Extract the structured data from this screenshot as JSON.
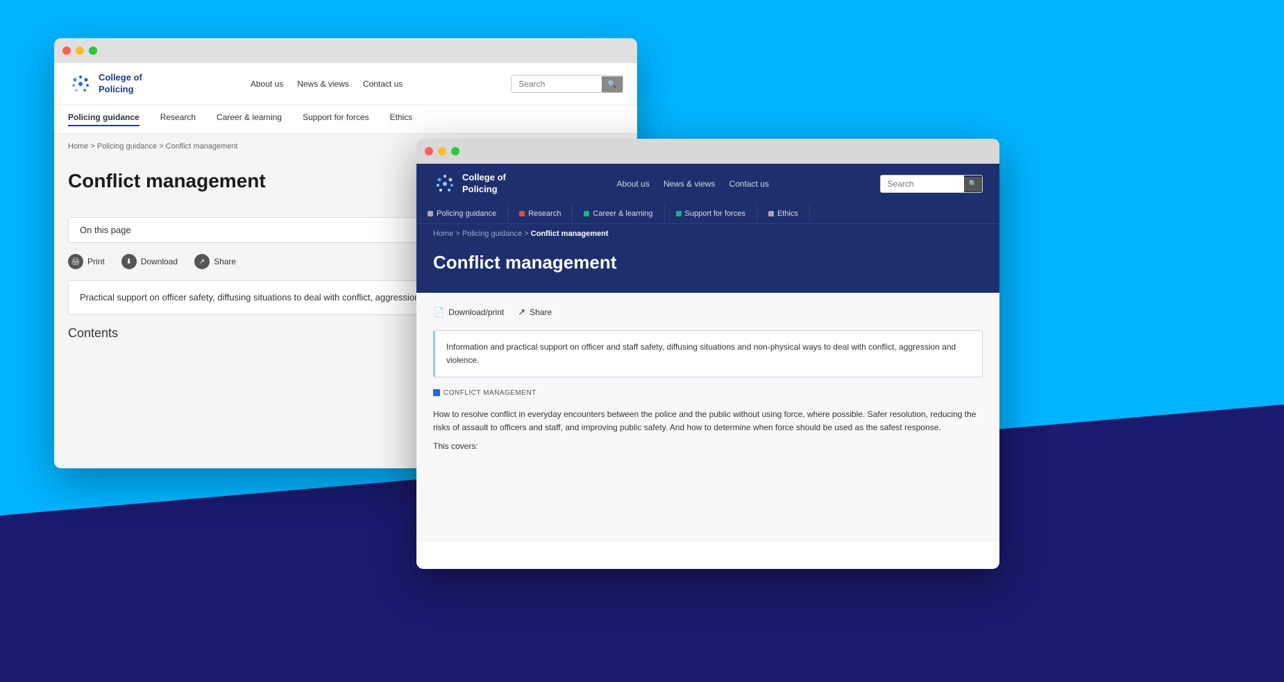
{
  "background": {
    "color": "#00b4ff"
  },
  "window1": {
    "titlebar": {
      "dots": [
        "red",
        "yellow",
        "green"
      ]
    },
    "header": {
      "logo_line1": "College of",
      "logo_line2": "Policing",
      "nav_items": [
        "About us",
        "News & views",
        "Contact us"
      ],
      "search_placeholder": "Search"
    },
    "subnav": {
      "items": [
        "Policing guidance",
        "Research",
        "Career & learning",
        "Support for forces",
        "Ethics"
      ],
      "active": "Policing guidance"
    },
    "breadcrumb": {
      "items": [
        "Home",
        "Policing guidance",
        "Conflict management"
      ],
      "separator": ">"
    },
    "hero": {
      "title": "Conflict management"
    },
    "on_this_page": "On this page",
    "chevron": "▼",
    "actions": [
      {
        "label": "Print",
        "icon": "print"
      },
      {
        "label": "Download",
        "icon": "download"
      },
      {
        "label": "Share",
        "icon": "share"
      }
    ],
    "description": "Practical support on officer safety, diffusing situations to deal with conflict, aggression and violence.",
    "section_heading": "Contents"
  },
  "window2": {
    "titlebar": {
      "dots": [
        "red",
        "yellow",
        "green"
      ]
    },
    "header": {
      "logo_line1": "College of",
      "logo_line2": "Policing",
      "nav_items": [
        "About us",
        "News & views",
        "Contact us"
      ],
      "search_placeholder": "Search"
    },
    "subnav": {
      "items": [
        {
          "label": "Policing guidance",
          "color": "#888"
        },
        {
          "label": "Research",
          "color": "#ef4444"
        },
        {
          "label": "Career & learning",
          "color": "#10b981"
        },
        {
          "label": "Support for forces",
          "color": "#10b981"
        },
        {
          "label": "Ethics",
          "color": "#888"
        }
      ]
    },
    "breadcrumb": {
      "items": [
        "Home",
        "Policing guidance",
        "Conflict management"
      ],
      "separator": ">",
      "current": "Conflict management"
    },
    "hero": {
      "title": "Conflict management"
    },
    "actions": [
      {
        "label": "Download/print",
        "icon": "download"
      },
      {
        "label": "Share",
        "icon": "share"
      }
    ],
    "description": "Information and practical support on officer and staff safety, diffusing situations and non-physical ways to deal with conflict, aggression and violence.",
    "tag": "CONFLICT MANAGEMENT",
    "body_text": "How to resolve conflict in everyday encounters between the police and the public without using force, where possible. Safer resolution, reducing the risks of assault to officers and staff, and improving public safety. And how to determine when force should be used as the safest response.",
    "covers_label": "This covers:"
  }
}
